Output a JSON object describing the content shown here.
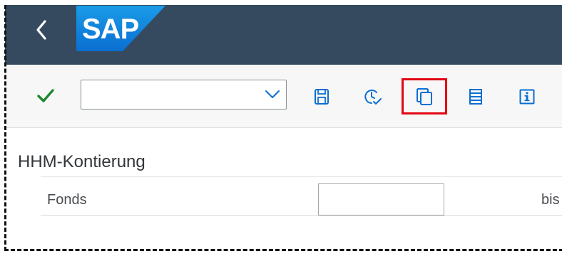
{
  "app": {
    "logo_text": "SAP",
    "brand_color": "#354a5f",
    "logo_color": "#0a6ed1"
  },
  "toolbar": {
    "command_field": {
      "value": "",
      "placeholder": ""
    },
    "icons": [
      "checkmark-icon",
      "save-icon",
      "clock-check-icon",
      "copy-icon",
      "list-icon",
      "info-icon"
    ],
    "highlighted": "copy-icon"
  },
  "form": {
    "section_title": "HHM-Kontierung",
    "fonds_label": "Fonds",
    "fonds_value": "",
    "to_label": "bis"
  }
}
